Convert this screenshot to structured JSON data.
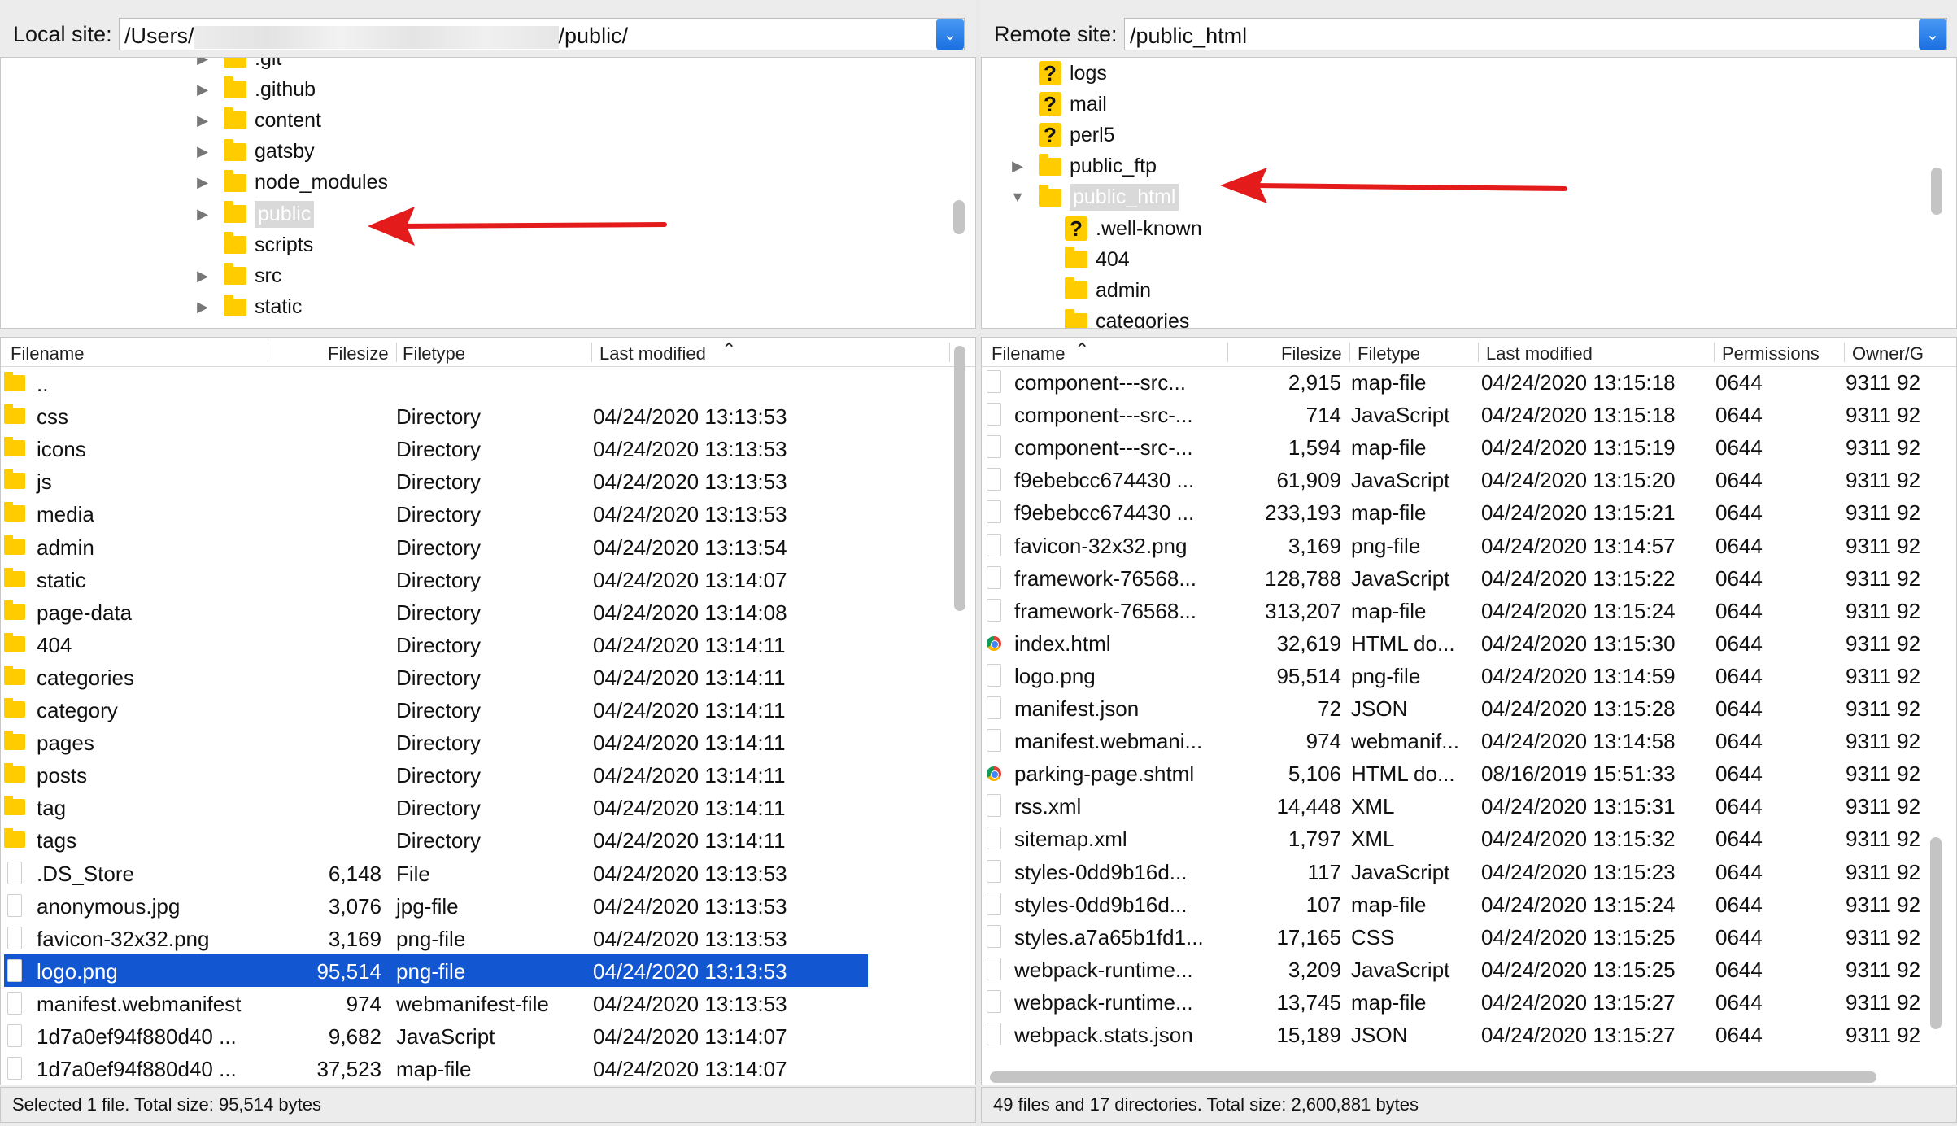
{
  "local": {
    "site_label": "Local site:",
    "path_prefix": "/Users/",
    "path_suffix": "/public/",
    "tree": [
      {
        "name": ".git",
        "expandable": true,
        "partial": true
      },
      {
        "name": ".github",
        "expandable": true
      },
      {
        "name": "content",
        "expandable": true
      },
      {
        "name": "gatsby",
        "expandable": true
      },
      {
        "name": "node_modules",
        "expandable": true
      },
      {
        "name": "public",
        "expandable": true,
        "selected": true
      },
      {
        "name": "scripts",
        "expandable": false
      },
      {
        "name": "src",
        "expandable": true
      },
      {
        "name": "static",
        "expandable": true
      }
    ],
    "columns": {
      "filename": "Filename",
      "filesize": "Filesize",
      "filetype": "Filetype",
      "last_modified": "Last modified"
    },
    "rows": [
      {
        "name": "..",
        "size": "",
        "type": "",
        "modified": "",
        "icon": "folder"
      },
      {
        "name": "css",
        "size": "",
        "type": "Directory",
        "modified": "04/24/2020 13:13:53",
        "icon": "folder"
      },
      {
        "name": "icons",
        "size": "",
        "type": "Directory",
        "modified": "04/24/2020 13:13:53",
        "icon": "folder"
      },
      {
        "name": "js",
        "size": "",
        "type": "Directory",
        "modified": "04/24/2020 13:13:53",
        "icon": "folder"
      },
      {
        "name": "media",
        "size": "",
        "type": "Directory",
        "modified": "04/24/2020 13:13:53",
        "icon": "folder"
      },
      {
        "name": "admin",
        "size": "",
        "type": "Directory",
        "modified": "04/24/2020 13:13:54",
        "icon": "folder"
      },
      {
        "name": "static",
        "size": "",
        "type": "Directory",
        "modified": "04/24/2020 13:14:07",
        "icon": "folder"
      },
      {
        "name": "page-data",
        "size": "",
        "type": "Directory",
        "modified": "04/24/2020 13:14:08",
        "icon": "folder"
      },
      {
        "name": "404",
        "size": "",
        "type": "Directory",
        "modified": "04/24/2020 13:14:11",
        "icon": "folder"
      },
      {
        "name": "categories",
        "size": "",
        "type": "Directory",
        "modified": "04/24/2020 13:14:11",
        "icon": "folder"
      },
      {
        "name": "category",
        "size": "",
        "type": "Directory",
        "modified": "04/24/2020 13:14:11",
        "icon": "folder"
      },
      {
        "name": "pages",
        "size": "",
        "type": "Directory",
        "modified": "04/24/2020 13:14:11",
        "icon": "folder"
      },
      {
        "name": "posts",
        "size": "",
        "type": "Directory",
        "modified": "04/24/2020 13:14:11",
        "icon": "folder"
      },
      {
        "name": "tag",
        "size": "",
        "type": "Directory",
        "modified": "04/24/2020 13:14:11",
        "icon": "folder"
      },
      {
        "name": "tags",
        "size": "",
        "type": "Directory",
        "modified": "04/24/2020 13:14:11",
        "icon": "folder"
      },
      {
        "name": ".DS_Store",
        "size": "6,148",
        "type": "File",
        "modified": "04/24/2020 13:13:53",
        "icon": "file"
      },
      {
        "name": "anonymous.jpg",
        "size": "3,076",
        "type": "jpg-file",
        "modified": "04/24/2020 13:13:53",
        "icon": "file"
      },
      {
        "name": "favicon-32x32.png",
        "size": "3,169",
        "type": "png-file",
        "modified": "04/24/2020 13:13:53",
        "icon": "file"
      },
      {
        "name": "logo.png",
        "size": "95,514",
        "type": "png-file",
        "modified": "04/24/2020 13:13:53",
        "icon": "file",
        "selected": true
      },
      {
        "name": "manifest.webmanifest",
        "size": "974",
        "type": "webmanifest-file",
        "modified": "04/24/2020 13:13:53",
        "icon": "file"
      },
      {
        "name": "1d7a0ef94f880d40 ...",
        "size": "9,682",
        "type": "JavaScript",
        "modified": "04/24/2020 13:14:07",
        "icon": "file"
      },
      {
        "name": "1d7a0ef94f880d40 ...",
        "size": "37,523",
        "type": "map-file",
        "modified": "04/24/2020 13:14:07",
        "icon": "file"
      }
    ],
    "status": "Selected 1 file. Total size: 95,514 bytes"
  },
  "remote": {
    "site_label": "Remote site:",
    "path": "/public_html",
    "tree": [
      {
        "name": "logs",
        "icon": "unknown",
        "indent": 0
      },
      {
        "name": "mail",
        "icon": "unknown",
        "indent": 0
      },
      {
        "name": "perl5",
        "icon": "unknown",
        "indent": 0
      },
      {
        "name": "public_ftp",
        "icon": "folder",
        "indent": 0,
        "toggle": "collapsed"
      },
      {
        "name": "public_html",
        "icon": "folder",
        "indent": 0,
        "toggle": "expanded",
        "selected": true
      },
      {
        "name": ".well-known",
        "icon": "unknown",
        "indent": 1
      },
      {
        "name": "404",
        "icon": "folder",
        "indent": 1
      },
      {
        "name": "admin",
        "icon": "folder",
        "indent": 1
      },
      {
        "name": "categories",
        "icon": "folder",
        "indent": 1
      }
    ],
    "columns": {
      "filename": "Filename",
      "filesize": "Filesize",
      "filetype": "Filetype",
      "last_modified": "Last modified",
      "permissions": "Permissions",
      "owner": "Owner/G"
    },
    "rows": [
      {
        "name": "component---src...",
        "size": "2,915",
        "type": "map-file",
        "modified": "04/24/2020 13:15:18",
        "perm": "0644",
        "owner": "9311 92",
        "icon": "file"
      },
      {
        "name": "component---src-...",
        "size": "714",
        "type": "JavaScript",
        "modified": "04/24/2020 13:15:18",
        "perm": "0644",
        "owner": "9311 92",
        "icon": "file"
      },
      {
        "name": "component---src-...",
        "size": "1,594",
        "type": "map-file",
        "modified": "04/24/2020 13:15:19",
        "perm": "0644",
        "owner": "9311 92",
        "icon": "file"
      },
      {
        "name": "f9ebebcc674430 ...",
        "size": "61,909",
        "type": "JavaScript",
        "modified": "04/24/2020 13:15:20",
        "perm": "0644",
        "owner": "9311 92",
        "icon": "file"
      },
      {
        "name": "f9ebebcc674430 ...",
        "size": "233,193",
        "type": "map-file",
        "modified": "04/24/2020 13:15:21",
        "perm": "0644",
        "owner": "9311 92",
        "icon": "file"
      },
      {
        "name": "favicon-32x32.png",
        "size": "3,169",
        "type": "png-file",
        "modified": "04/24/2020 13:14:57",
        "perm": "0644",
        "owner": "9311 92",
        "icon": "file"
      },
      {
        "name": "framework-76568...",
        "size": "128,788",
        "type": "JavaScript",
        "modified": "04/24/2020 13:15:22",
        "perm": "0644",
        "owner": "9311 92",
        "icon": "file"
      },
      {
        "name": "framework-76568...",
        "size": "313,207",
        "type": "map-file",
        "modified": "04/24/2020 13:15:24",
        "perm": "0644",
        "owner": "9311 92",
        "icon": "file"
      },
      {
        "name": "index.html",
        "size": "32,619",
        "type": "HTML do...",
        "modified": "04/24/2020 13:15:30",
        "perm": "0644",
        "owner": "9311 92",
        "icon": "chrome"
      },
      {
        "name": "logo.png",
        "size": "95,514",
        "type": "png-file",
        "modified": "04/24/2020 13:14:59",
        "perm": "0644",
        "owner": "9311 92",
        "icon": "file"
      },
      {
        "name": "manifest.json",
        "size": "72",
        "type": "JSON",
        "modified": "04/24/2020 13:15:28",
        "perm": "0644",
        "owner": "9311 92",
        "icon": "file"
      },
      {
        "name": "manifest.webmani...",
        "size": "974",
        "type": "webmanif...",
        "modified": "04/24/2020 13:14:58",
        "perm": "0644",
        "owner": "9311 92",
        "icon": "file"
      },
      {
        "name": "parking-page.shtml",
        "size": "5,106",
        "type": "HTML do...",
        "modified": "08/16/2019 15:51:33",
        "perm": "0644",
        "owner": "9311 92",
        "icon": "chrome"
      },
      {
        "name": "rss.xml",
        "size": "14,448",
        "type": "XML",
        "modified": "04/24/2020 13:15:31",
        "perm": "0644",
        "owner": "9311 92",
        "icon": "file"
      },
      {
        "name": "sitemap.xml",
        "size": "1,797",
        "type": "XML",
        "modified": "04/24/2020 13:15:32",
        "perm": "0644",
        "owner": "9311 92",
        "icon": "file"
      },
      {
        "name": "styles-0dd9b16d...",
        "size": "117",
        "type": "JavaScript",
        "modified": "04/24/2020 13:15:23",
        "perm": "0644",
        "owner": "9311 92",
        "icon": "file"
      },
      {
        "name": "styles-0dd9b16d...",
        "size": "107",
        "type": "map-file",
        "modified": "04/24/2020 13:15:24",
        "perm": "0644",
        "owner": "9311 92",
        "icon": "file"
      },
      {
        "name": "styles.a7a65b1fd1...",
        "size": "17,165",
        "type": "CSS",
        "modified": "04/24/2020 13:15:25",
        "perm": "0644",
        "owner": "9311 92",
        "icon": "file"
      },
      {
        "name": "webpack-runtime...",
        "size": "3,209",
        "type": "JavaScript",
        "modified": "04/24/2020 13:15:25",
        "perm": "0644",
        "owner": "9311 92",
        "icon": "file"
      },
      {
        "name": "webpack-runtime...",
        "size": "13,745",
        "type": "map-file",
        "modified": "04/24/2020 13:15:27",
        "perm": "0644",
        "owner": "9311 92",
        "icon": "file"
      },
      {
        "name": "webpack.stats.json",
        "size": "15,189",
        "type": "JSON",
        "modified": "04/24/2020 13:15:27",
        "perm": "0644",
        "owner": "9311 92",
        "icon": "file"
      }
    ],
    "status": "49 files and 17 directories. Total size: 2,600,881 bytes"
  },
  "colors": {
    "selection": "#1256d1",
    "folder": "#ffcc00",
    "arrow": "#e41b1b"
  }
}
